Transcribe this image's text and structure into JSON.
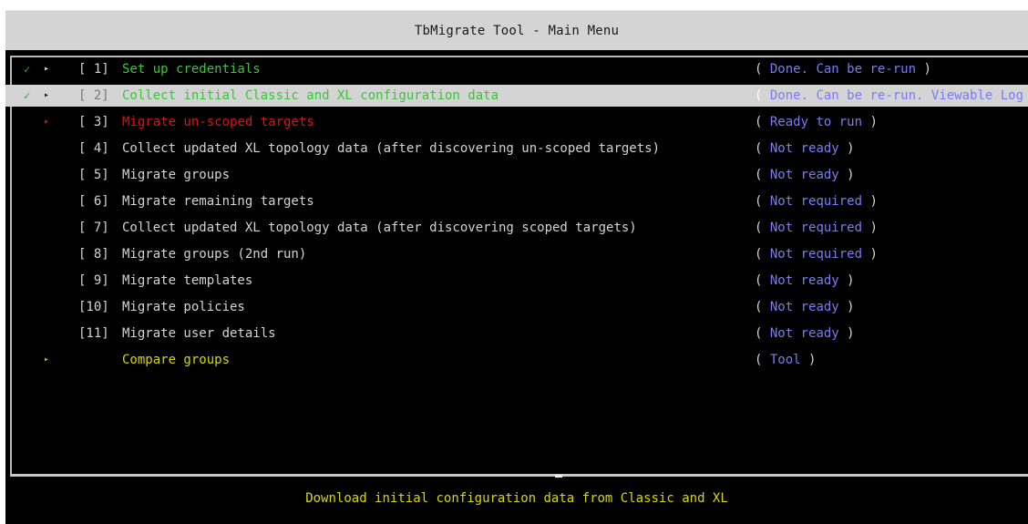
{
  "window": {
    "title": "TbMigrate Tool - Main Menu"
  },
  "colors": {
    "done": "#3cc43c",
    "current": "#e01010",
    "pending": "#d4d4d4",
    "tool": "#d8d800",
    "status": "#7b7bf5",
    "selected_bg": "#d4d4d4"
  },
  "menu": {
    "items": [
      {
        "check": "✓",
        "bullet": "▸",
        "num": "[ 1]",
        "label": "Set up credentials",
        "status_text": "Done. Can be re-run",
        "open": "(",
        "close": ")"
      },
      {
        "check": "✓",
        "bullet": "▸",
        "num": "[ 2]",
        "label": "Collect initial Classic and XL configuration data",
        "status_text": "Done. Can be re-run. Viewable Log",
        "open": "(",
        "close": ""
      },
      {
        "check": "",
        "bullet": "▸",
        "num": "[ 3]",
        "label": "Migrate un-scoped targets",
        "status_text": "Ready to run",
        "open": "(",
        "close": ")"
      },
      {
        "check": "",
        "bullet": "",
        "num": "[ 4]",
        "label": "Collect updated XL topology data (after discovering un-scoped targets)",
        "status_text": "Not ready",
        "open": "(",
        "close": ")"
      },
      {
        "check": "",
        "bullet": "",
        "num": "[ 5]",
        "label": "Migrate groups",
        "status_text": "Not ready",
        "open": "(",
        "close": ")"
      },
      {
        "check": "",
        "bullet": "",
        "num": "[ 6]",
        "label": "Migrate remaining targets",
        "status_text": "Not required",
        "open": "(",
        "close": ")"
      },
      {
        "check": "",
        "bullet": "",
        "num": "[ 7]",
        "label": "Collect updated XL topology data (after discovering scoped targets)",
        "status_text": "Not required",
        "open": "(",
        "close": ")"
      },
      {
        "check": "",
        "bullet": "",
        "num": "[ 8]",
        "label": "Migrate groups (2nd run)",
        "status_text": "Not required",
        "open": "(",
        "close": ")"
      },
      {
        "check": "",
        "bullet": "",
        "num": "[ 9]",
        "label": "Migrate templates",
        "status_text": "Not ready",
        "open": "(",
        "close": ")"
      },
      {
        "check": "",
        "bullet": "",
        "num": "[10]",
        "label": "Migrate policies",
        "status_text": "Not ready",
        "open": "(",
        "close": ")"
      },
      {
        "check": "",
        "bullet": "",
        "num": "[11]",
        "label": "Migrate user details",
        "status_text": "Not ready",
        "open": "(",
        "close": ")"
      },
      {
        "check": "",
        "bullet": "▸",
        "num": "",
        "label": "Compare groups",
        "status_text": "Tool",
        "open": "(",
        "close": ")"
      }
    ]
  },
  "footer": {
    "description": "Download initial configuration data from Classic and XL"
  }
}
